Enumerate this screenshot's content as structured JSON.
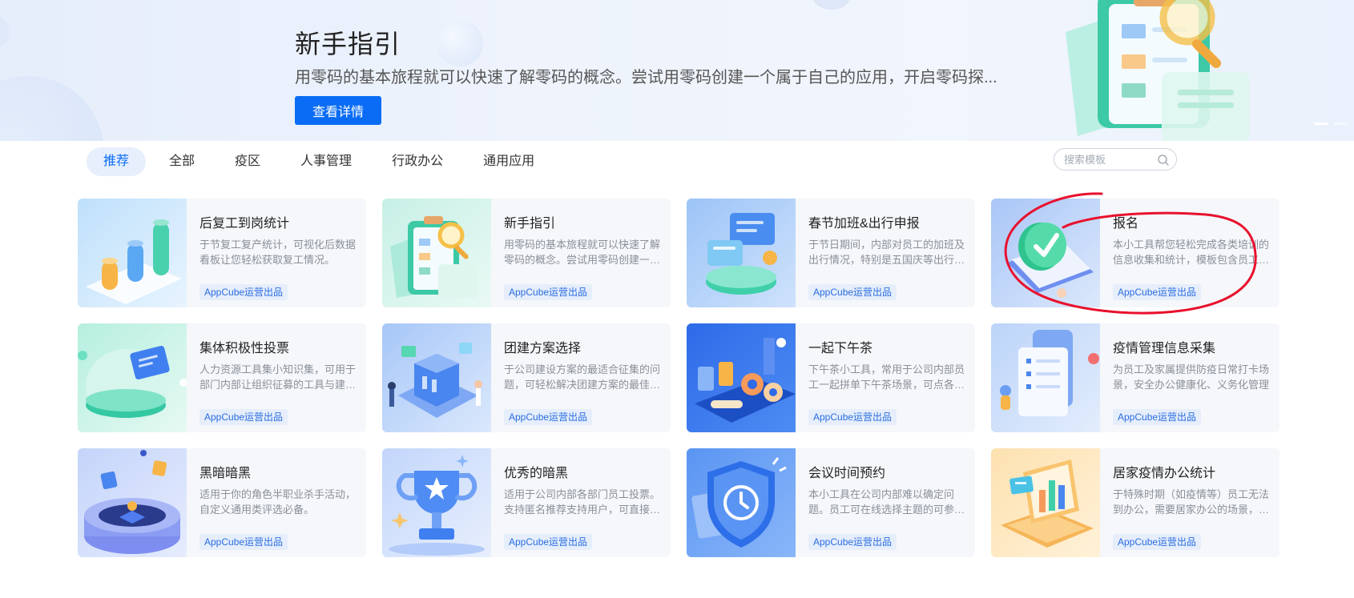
{
  "banner": {
    "title": "新手指引",
    "description": "用零码的基本旅程就可以快速了解零码的概念。尝试用零码创建一个属于自己的应用，开启零码探...",
    "button_label": "查看详情"
  },
  "tabs": [
    {
      "label": "推荐",
      "active": true
    },
    {
      "label": "全部",
      "active": false
    },
    {
      "label": "疫区",
      "active": false
    },
    {
      "label": "人事管理",
      "active": false
    },
    {
      "label": "行政办公",
      "active": false
    },
    {
      "label": "通用应用",
      "active": false
    }
  ],
  "search": {
    "placeholder": "搜索模板"
  },
  "cards": [
    {
      "title": "后复工到岗统计",
      "desc": "于节复工复产统计，可视化后数据看板让您轻松获取复工情况。",
      "tag": "AppCube运营出品",
      "icon": "bar-chart-icon"
    },
    {
      "title": "新手指引",
      "desc": "用零码的基本旅程就可以快速了解零码的概念。尝试用零码创建一个属于自己的应用",
      "tag": "AppCube运营出品",
      "icon": "clipboard-magnifier-icon"
    },
    {
      "title": "春节加班&出行申报",
      "desc": "于节日期间，内部对员工的加班及出行情况，特别是五国庆等出行情况",
      "tag": "AppCube运营出品",
      "icon": "chat-bubbles-icon"
    },
    {
      "title": "报名",
      "desc": "本小工具帮您轻松完成各类培训的信息收集和统计，模板包含员工信息",
      "tag": "AppCube运营出品",
      "icon": "checkmark-badge-icon"
    },
    {
      "title": "集体积极性投票",
      "desc": "人力资源工具集小知识集，可用于部门内部让组织征募的工具与建议收集",
      "tag": "AppCube运营出品",
      "icon": "ballot-card-icon"
    },
    {
      "title": "团建方案选择",
      "desc": "于公司建设方案的最适合征集的问题，可轻松解决团建方案的最佳选择",
      "tag": "AppCube运营出品",
      "icon": "team-building-icon"
    },
    {
      "title": "一起下午茶",
      "desc": "下午茶小工具，常用于公司内部员工一起拼单下午茶场景，可点各类茶点",
      "tag": "AppCube运营出品",
      "icon": "afternoon-tea-icon"
    },
    {
      "title": "疫情管理信息采集",
      "desc": "为员工及家属提供防疫日常打卡场景，安全办公健康化、义务化管理",
      "tag": "AppCube运营出品",
      "icon": "health-report-icon"
    },
    {
      "title": "黑暗暗黑",
      "desc": "适用于你的角色半职业杀手活动，自定义通用类评选必备。",
      "tag": "AppCube运营出品",
      "icon": "game-stage-icon"
    },
    {
      "title": "优秀的暗黑",
      "desc": "适用于公司内部各部门员工投票。支持匿名推荐支持用户，可直接发起",
      "tag": "AppCube运营出品",
      "icon": "trophy-icon"
    },
    {
      "title": "会议时间预约",
      "desc": "本小工具在公司内部难以确定问题。员工可在线选择主题的可参加时间",
      "tag": "AppCube运营出品",
      "icon": "shield-clock-icon"
    },
    {
      "title": "居家疫情办公统计",
      "desc": "于特殊时期（如疫情等）员工无法到办公，需要居家办公的场景，统计",
      "tag": "AppCube运营出品",
      "icon": "laptop-chart-icon"
    }
  ],
  "colors": {
    "accent": "#0a6cf5",
    "tag_bg": "#e6eefb",
    "annotation": "#e8112d"
  }
}
